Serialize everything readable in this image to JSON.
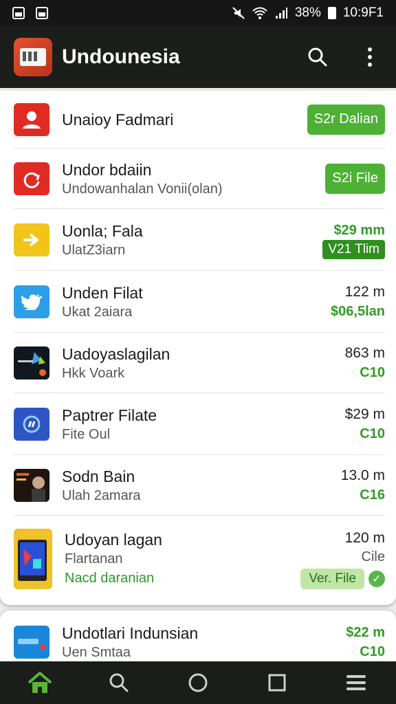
{
  "status_bar": {
    "battery": "38%",
    "time": "10:9F1"
  },
  "app_bar": {
    "title": "Undounesia"
  },
  "items": [
    {
      "title": "Unaioy Fadmari",
      "subtitle": "",
      "action": "S2r Dalian",
      "icon": "user-icon",
      "color": "#e02b25"
    },
    {
      "title": "Undor bdaiin",
      "subtitle": "Undowanhalan Vonii(olan)",
      "action": "S2i File",
      "icon": "refresh-icon",
      "color": "#e02b25"
    },
    {
      "title": "Uonla; Fala",
      "subtitle": "UlatZ3iarn",
      "price": "$29 mm",
      "badge": "V21 Tlim",
      "icon": "arrow-icon",
      "color": "#f0c419"
    },
    {
      "title": "Unden Filat",
      "subtitle": "Ukat 2aiara",
      "price": "122 m",
      "price_sub": "$06,5lan",
      "icon": "bird-icon",
      "color": "#2d9ee8"
    },
    {
      "title": "Uadoyaslagilan",
      "subtitle": "Hkk Voark",
      "price": "863 m",
      "price_sub": "C10",
      "icon": "media-thumb-icon",
      "color": "#111111"
    },
    {
      "title": "Paptrer Filate",
      "subtitle": "Fite Oul",
      "price": "$29 m",
      "price_sub": "C10",
      "icon": "link-icon",
      "color": "#2f54c4"
    },
    {
      "title": "Sodn Bain",
      "subtitle": "Ulah 2amara",
      "price": "13.0 m",
      "price_sub": "C16",
      "icon": "video-thumb-icon",
      "color": "#2a1a10"
    },
    {
      "title": "Udoyan lagan",
      "subtitle": "Flartanan",
      "extra": "Nacd daranian",
      "price": "120 m",
      "price_sub": "Cile",
      "badge": "Ver. File",
      "icon": "tablet-thumb-icon",
      "color": "#e8b91a"
    },
    {
      "title": "Undotlari Indunsian",
      "subtitle": "Uen Smtaa",
      "price": "$22 m",
      "price_sub": "C10",
      "icon": "app-thumb-icon",
      "color": "#1a86d8"
    }
  ]
}
